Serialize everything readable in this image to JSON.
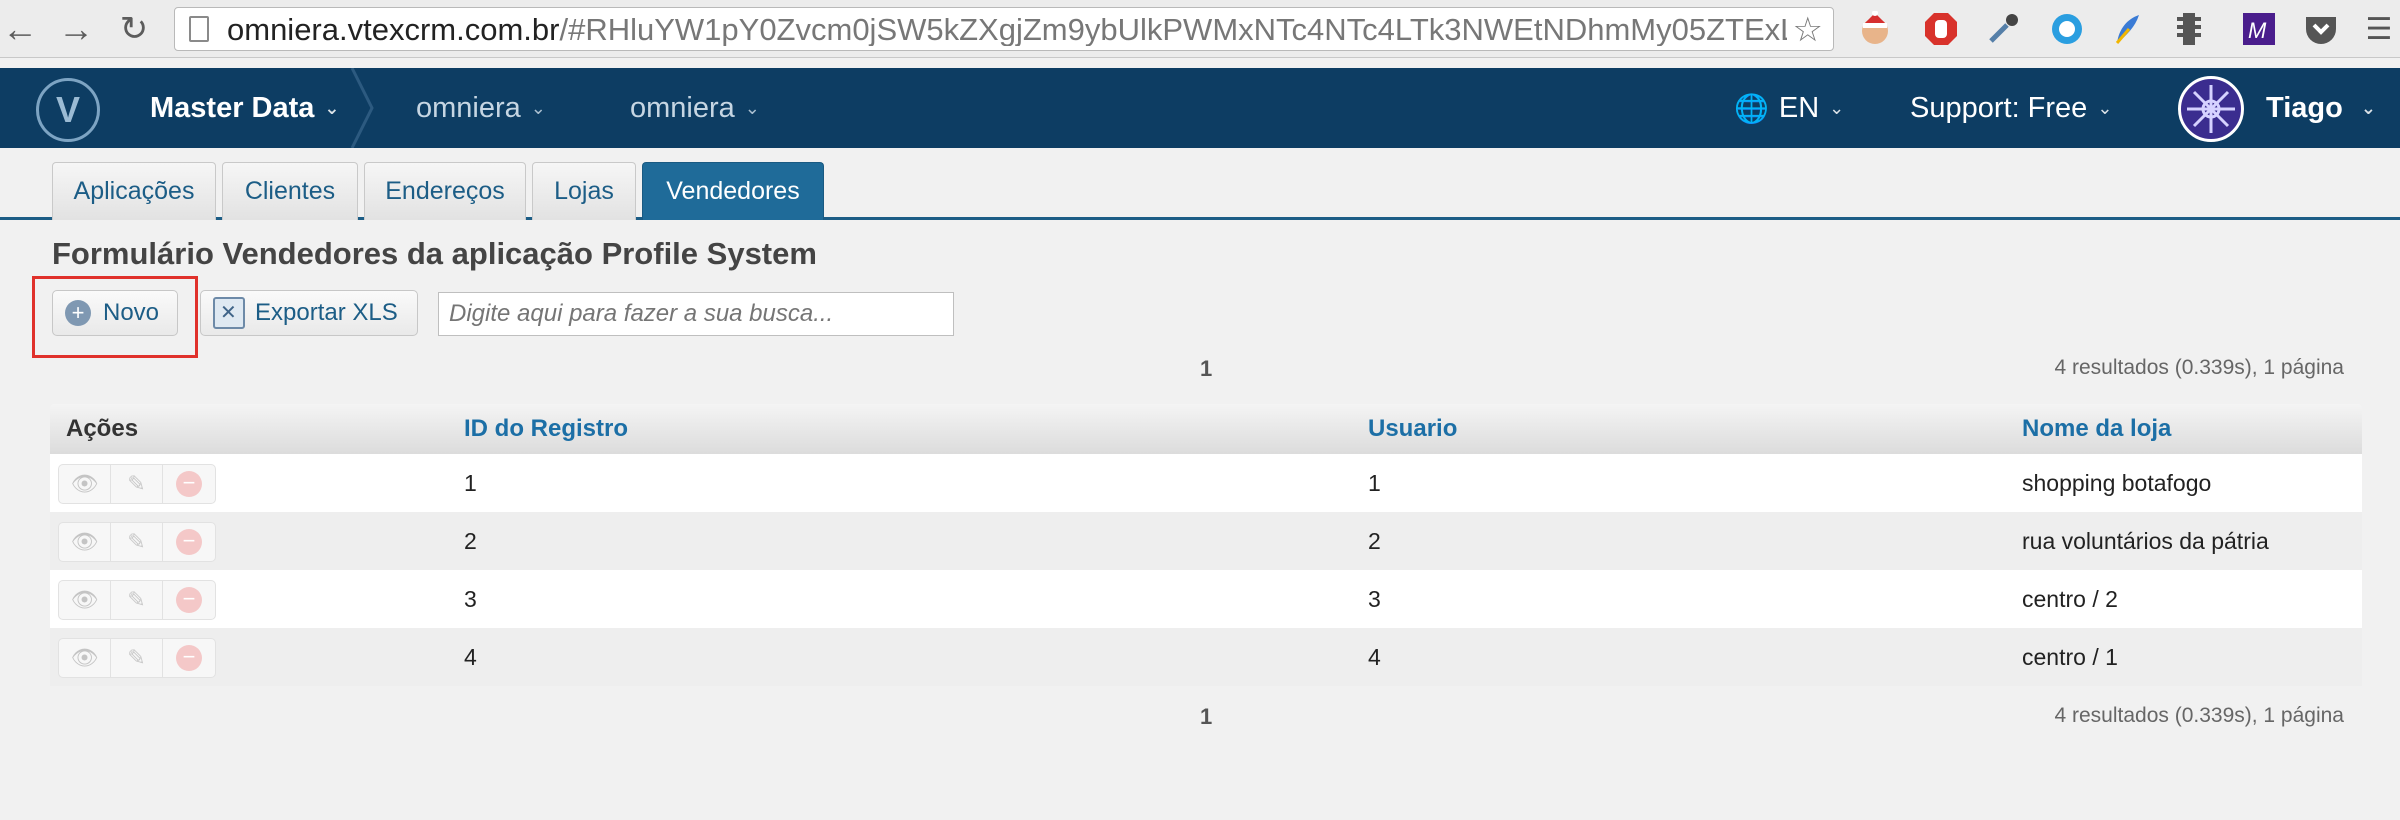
{
  "browser": {
    "url_host": "omniera.vtexcrm.com.br",
    "url_rest": "/#RHluYW1pY0Zvcm0jSW5kZXgjZm9ybUlkPWMxNTc4NTc4LTk3NWEtNDhmMy05ZTExLTEz..."
  },
  "header": {
    "app_name": "Master Data",
    "breadcrumb_1": "omniera",
    "breadcrumb_2": "omniera",
    "language": "EN",
    "support": "Support: Free",
    "user": "Tiago",
    "brand_color": "#0d3d63"
  },
  "tabs": [
    {
      "label": "Aplicações"
    },
    {
      "label": "Clientes"
    },
    {
      "label": "Endereços"
    },
    {
      "label": "Lojas"
    },
    {
      "label": "Vendedores",
      "active": true
    }
  ],
  "page": {
    "title": "Formulário Vendedores da aplicação Profile System",
    "new_button": "Novo",
    "export_button": "Exportar XLS",
    "search_placeholder": "Digite aqui para fazer a sua busca...",
    "page_number": "1",
    "results_text": "4 resultados (0.339s), 1 página"
  },
  "table": {
    "columns": [
      "Ações",
      "ID do Registro",
      "Usuario",
      "Nome da loja"
    ],
    "rows": [
      {
        "id": "1",
        "usuario": "1",
        "loja": "shopping botafogo"
      },
      {
        "id": "2",
        "usuario": "2",
        "loja": "rua voluntários da pátria"
      },
      {
        "id": "3",
        "usuario": "3",
        "loja": "centro / 2"
      },
      {
        "id": "4",
        "usuario": "4",
        "loja": "centro / 1"
      }
    ]
  }
}
